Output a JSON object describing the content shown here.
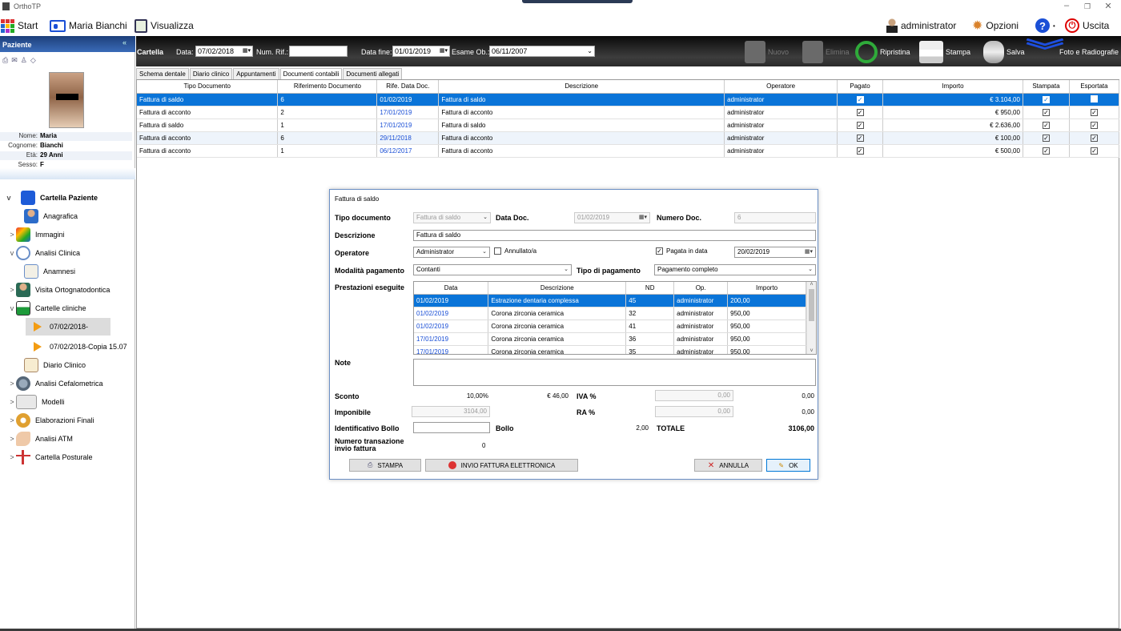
{
  "app": {
    "title": "OrthoTP"
  },
  "menu": {
    "start": "Start",
    "patient_name": "Maria Bianchi",
    "visualizza": "Visualizza",
    "user": "administrator",
    "opzioni": "Opzioni",
    "help": "?",
    "uscita": "Uscita"
  },
  "toolbar": {
    "cartella": "Cartella",
    "data_label": "Data:",
    "data_value": "07/02/2018",
    "numrif_label": "Num. Rif.:",
    "numrif_value": "",
    "datafine_label": "Data fine:",
    "datafine_value": "01/01/2019",
    "esame_label": "Esame Ob.:",
    "esame_value": "06/11/2007",
    "nuovo": "Nuovo",
    "elimina": "Elimina",
    "ripristina": "Ripristina",
    "stampa": "Stampa",
    "salva": "Salva",
    "foto": "Foto e Radiografie"
  },
  "sidebar": {
    "header": "Paziente",
    "fields": [
      {
        "k": "Nome:",
        "v": "Maria"
      },
      {
        "k": "Cognome:",
        "v": "Bianchi"
      },
      {
        "k": "Età:",
        "v": "29 Anni"
      },
      {
        "k": "Sesso:",
        "v": "F"
      }
    ],
    "tree": [
      {
        "label": "Cartella Paziente",
        "chev": "v",
        "bold": true
      },
      {
        "label": "Anagrafica",
        "chev": ""
      },
      {
        "label": "Immagini",
        "chev": ">"
      },
      {
        "label": "Analisi Clinica",
        "chev": "v"
      },
      {
        "label": "Anamnesi",
        "chev": ""
      },
      {
        "label": "Visita Ortognatodontica",
        "chev": ">"
      },
      {
        "label": "Cartelle cliniche",
        "chev": "v"
      },
      {
        "label": "07/02/2018-",
        "chev": ""
      },
      {
        "label": "07/02/2018-Copia 15.07",
        "chev": ""
      },
      {
        "label": "Diario Clinico",
        "chev": ""
      },
      {
        "label": "Analisi Cefalometrica",
        "chev": ">"
      },
      {
        "label": "Modelli",
        "chev": ">"
      },
      {
        "label": "Elaborazioni Finali",
        "chev": ">"
      },
      {
        "label": "Analisi ATM",
        "chev": ">"
      },
      {
        "label": "Cartella Posturale",
        "chev": ">"
      }
    ]
  },
  "tabs": [
    "Schema dentale",
    "Diario clinico",
    "Appuntamenti",
    "Documenti contabili",
    "Documenti allegati"
  ],
  "grid": {
    "columns": [
      "Tipo Documento",
      "Riferimento Documento",
      "Rife. Data Doc.",
      "Descrizione",
      "Operatore",
      "Pagato",
      "Importo",
      "Stampata",
      "Esportata"
    ],
    "rows": [
      {
        "tipo": "Fattura di saldo",
        "rif": "6",
        "data": "01/02/2019",
        "desc": "Fattura di saldo",
        "op": "administrator",
        "pagato": "✓",
        "importo": "€ 3.104,00",
        "stampata": "✓",
        "esportata": ""
      },
      {
        "tipo": "Fattura di acconto",
        "rif": "2",
        "data": "17/01/2019",
        "desc": "Fattura di acconto",
        "op": "administrator",
        "pagato": "✓",
        "importo": "€ 950,00",
        "stampata": "✓",
        "esportata": "✓"
      },
      {
        "tipo": "Fattura di saldo",
        "rif": "1",
        "data": "17/01/2019",
        "desc": "Fattura di saldo",
        "op": "administrator",
        "pagato": "✓",
        "importo": "€ 2.636,00",
        "stampata": "✓",
        "esportata": "✓"
      },
      {
        "tipo": "Fattura di acconto",
        "rif": "6",
        "data": "29/11/2018",
        "desc": "Fattura di acconto",
        "op": "administrator",
        "pagato": "✓",
        "importo": "€ 100,00",
        "stampata": "✓",
        "esportata": "✓"
      },
      {
        "tipo": "Fattura di acconto",
        "rif": "1",
        "data": "06/12/2017",
        "desc": "Fattura di acconto",
        "op": "administrator",
        "pagato": "✓",
        "importo": "€ 500,00",
        "stampata": "✓",
        "esportata": "✓"
      }
    ]
  },
  "dialog": {
    "title": "Fattura di saldo",
    "tipo_label": "Tipo documento",
    "tipo_value": "Fattura di saldo",
    "datadoc_label": "Data Doc.",
    "datadoc_value": "01/02/2019",
    "numdoc_label": "Numero Doc.",
    "numdoc_value": "6",
    "desc_label": "Descrizione",
    "desc_value": "Fattura di saldo",
    "operatore_label": "Operatore",
    "operatore_value": "Administrator",
    "annullato_label": "Annullato/a",
    "pagata_label": "Pagata in data",
    "pagata_value": "20/02/2019",
    "modalita_label": "Modalità pagamento",
    "modalita_value": "Contanti",
    "tipopag_label": "Tipo di pagamento",
    "tipopag_value": "Pagamento completo",
    "prest_label": "Prestazioni eseguite",
    "prest_columns": [
      "Data",
      "Descrizione",
      "ND",
      "Op.",
      "Importo"
    ],
    "prest_rows": [
      {
        "data": "01/02/2019",
        "desc": "Estrazione dentaria complessa",
        "nd": "45",
        "op": "administrator",
        "imp": "200,00"
      },
      {
        "data": "01/02/2019",
        "desc": "Corona zirconia ceramica",
        "nd": "32",
        "op": "administrator",
        "imp": "950,00"
      },
      {
        "data": "01/02/2019",
        "desc": "Corona zirconia ceramica",
        "nd": "41",
        "op": "administrator",
        "imp": "950,00"
      },
      {
        "data": "17/01/2019",
        "desc": "Corona zirconia ceramica",
        "nd": "36",
        "op": "administrator",
        "imp": "950,00"
      },
      {
        "data": "17/01/2019",
        "desc": "Corona zirconia ceramica",
        "nd": "35",
        "op": "administrator",
        "imp": "950,00"
      }
    ],
    "note_label": "Note",
    "sconto_label": "Sconto",
    "sconto_pct": "10,00%",
    "sconto_eur": "€ 46,00",
    "iva_label": "IVA %",
    "iva_value": "0,00",
    "iva_amount": "0,00",
    "imponibile_label": "Imponibile",
    "imponibile_value": "3104,00",
    "ra_label": "RA %",
    "ra_value": "0,00",
    "ra_amount": "0,00",
    "bollo_id_label": "Identificativo Bollo",
    "bollo_label": "Bollo",
    "bollo_value": "2,00",
    "totale_label": "TOTALE",
    "totale_value": "3106,00",
    "transazione_label": "Numero transazione invio fattura",
    "transazione_value": "0",
    "btn_stampa": "STAMPA",
    "btn_invio": "INVIO FATTURA ELETTRONICA",
    "btn_annulla": "ANNULLA",
    "btn_ok": "OK"
  }
}
